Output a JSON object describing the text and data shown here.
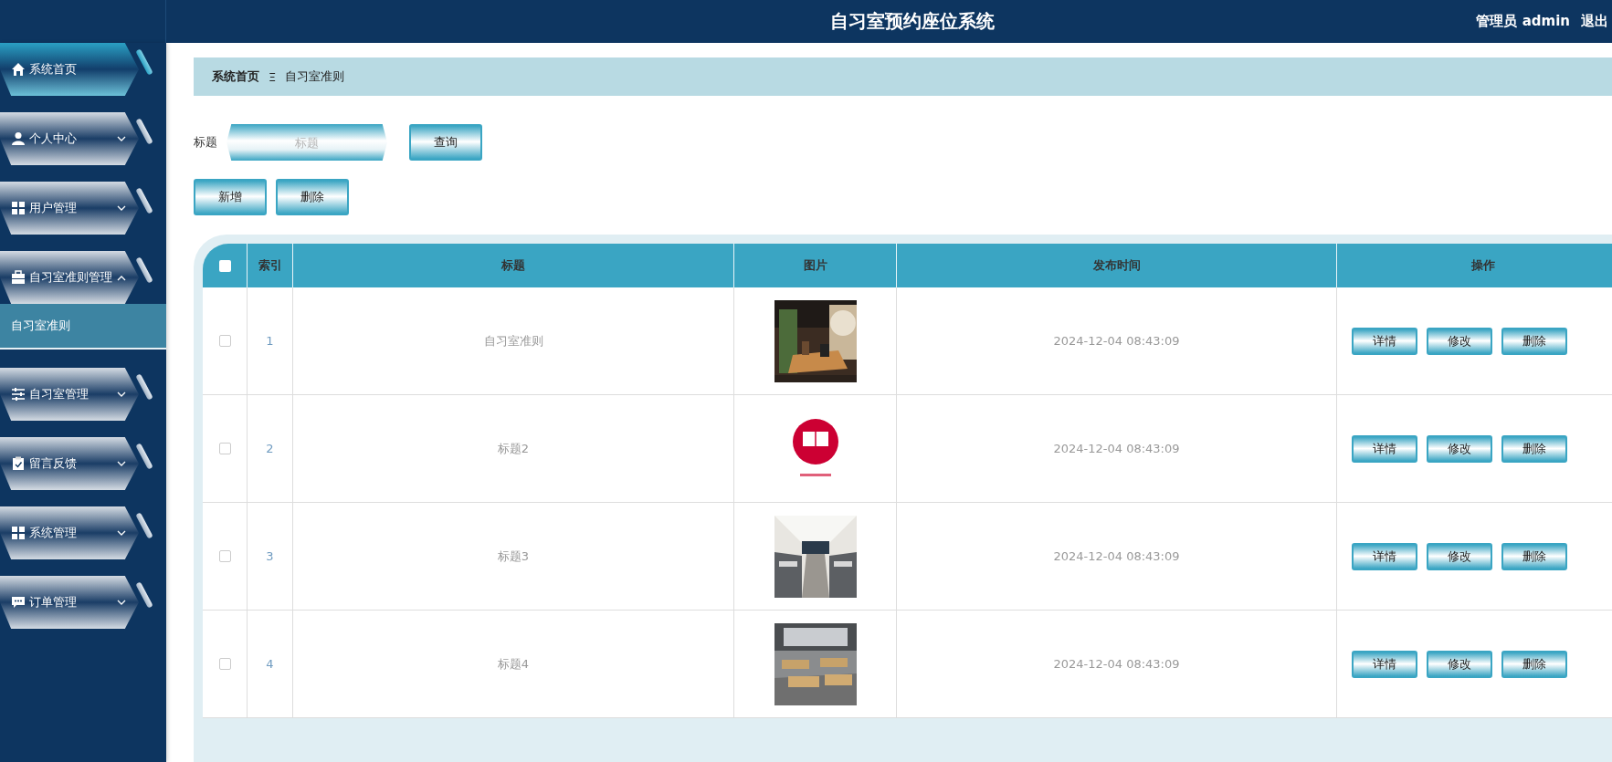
{
  "header": {
    "title": "自习室预约座位系统",
    "user": "管理员 admin",
    "logout": "退出"
  },
  "sidebar": {
    "items": [
      {
        "kind": "link",
        "label": "系统首页",
        "highlighted": true
      },
      {
        "kind": "menu",
        "label": "个人中心",
        "highlighted": false,
        "expanded": false
      },
      {
        "kind": "menu",
        "label": "用户管理",
        "highlighted": false,
        "expanded": false
      },
      {
        "kind": "menu",
        "label": "自习室准则管理",
        "highlighted": false,
        "expanded": true,
        "children": [
          {
            "label": "自习室准则",
            "selected": true
          }
        ]
      },
      {
        "kind": "menu",
        "label": "自习室管理",
        "highlighted": false,
        "expanded": false
      },
      {
        "kind": "menu",
        "label": "留言反馈",
        "highlighted": false,
        "expanded": false
      },
      {
        "kind": "menu",
        "label": "系统管理",
        "highlighted": false,
        "expanded": false
      },
      {
        "kind": "menu",
        "label": "订单管理",
        "highlighted": false,
        "expanded": false
      }
    ]
  },
  "breadcrumb": {
    "home": "系统首页",
    "separator": "Ξ",
    "current": "自习室准则"
  },
  "search": {
    "label": "标题",
    "placeholder": "标题",
    "button": "查询"
  },
  "toolbar": [
    "新增",
    "删除"
  ],
  "table": {
    "header_checked": false,
    "columns": [
      "索引",
      "标题",
      "图片",
      "发布时间",
      "操作"
    ],
    "rows": [
      {
        "checked": false,
        "index": "1",
        "title": "自习室准则",
        "time": "2024-12-04 08:43:09",
        "actions": [
          "详情",
          "修改",
          "删除"
        ]
      },
      {
        "checked": false,
        "index": "2",
        "title": "标题2",
        "time": "2024-12-04 08:43:09",
        "actions": [
          "详情",
          "修改",
          "删除"
        ]
      },
      {
        "checked": false,
        "index": "3",
        "title": "标题3",
        "time": "2024-12-04 08:43:09",
        "actions": [
          "详情",
          "修改",
          "删除"
        ]
      },
      {
        "checked": false,
        "index": "4",
        "title": "标题4",
        "time": "2024-12-04 08:43:09",
        "actions": [
          "详情",
          "修改",
          "删除"
        ]
      }
    ]
  }
}
